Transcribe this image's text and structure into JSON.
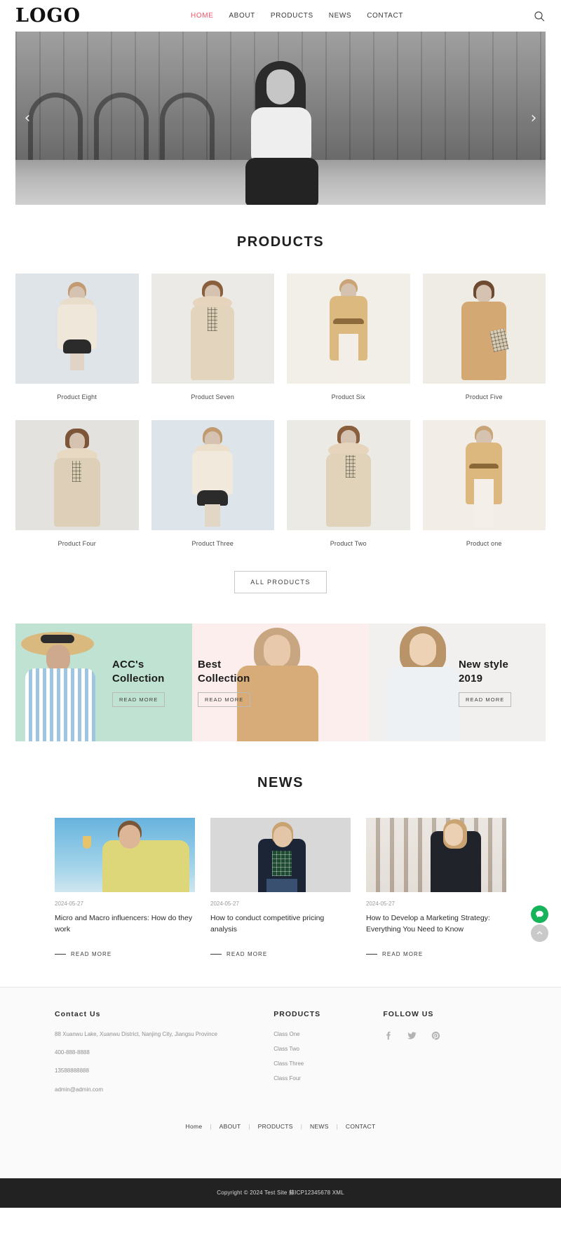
{
  "header": {
    "logo": "LOGO",
    "nav": [
      {
        "label": "HOME",
        "active": true
      },
      {
        "label": "ABOUT",
        "active": false
      },
      {
        "label": "PRODUCTS",
        "active": false
      },
      {
        "label": "NEWS",
        "active": false
      },
      {
        "label": "CONTACT",
        "active": false
      }
    ],
    "search_icon": "search-icon"
  },
  "hero": {
    "prev_arrow": "‹",
    "next_arrow": "›"
  },
  "products": {
    "title": "PRODUCTS",
    "items": [
      {
        "label": "Product Eight"
      },
      {
        "label": "Product Seven"
      },
      {
        "label": "Product Six"
      },
      {
        "label": "Product Five"
      },
      {
        "label": "Product Four"
      },
      {
        "label": "Product Three"
      },
      {
        "label": "Product Two"
      },
      {
        "label": "Product one"
      }
    ],
    "all_products_label": "ALL PRODUCTS"
  },
  "banners": [
    {
      "title": "ACC's\nCollection",
      "button": "READ MORE",
      "bg": "#bfe2d2"
    },
    {
      "title": "Best\nCollection",
      "button": "READ MORE",
      "bg": "#fbeeec"
    },
    {
      "title": "New style\n2019",
      "button": "READ MORE",
      "bg": "#f2f0ee"
    }
  ],
  "news": {
    "title": "NEWS",
    "items": [
      {
        "date": "2024-05-27",
        "headline": "Micro and Macro influencers: How do they work",
        "read_more": "READ MORE"
      },
      {
        "date": "2024-05-27",
        "headline": "How to conduct competitive pricing analysis",
        "read_more": "READ MORE"
      },
      {
        "date": "2024-05-27",
        "headline": "How to Develop a Marketing Strategy: Everything You Need to Know",
        "read_more": "READ MORE"
      }
    ]
  },
  "floating": {
    "chat_icon": "chat-bubble-icon",
    "back_to_top_icon": "chevron-up-icon"
  },
  "footer": {
    "contact": {
      "heading": "Contact Us",
      "address": "88 Xuanwu Lake, Xuanwu District, Nanjing City, Jiangsu Province",
      "phone": "400-888-8888",
      "mobile": "13588888888",
      "email": "admin@admin.com"
    },
    "products": {
      "heading": "PRODUCTS",
      "links": [
        "Class One",
        "Class Two",
        "Class Three",
        "Class Four"
      ]
    },
    "follow": {
      "heading": "FOLLOW US",
      "socials": [
        "facebook-icon",
        "twitter-icon",
        "pinterest-icon"
      ]
    },
    "nav": [
      "Home",
      "ABOUT",
      "PRODUCTS",
      "NEWS",
      "CONTACT"
    ],
    "separator": "|",
    "copyright": "Copyright © 2024 Test Site 蘇ICP12345678 XML"
  },
  "colors": {
    "accent": "#f5546a",
    "chat_green": "#16b35b",
    "dark_bar": "#222222"
  }
}
